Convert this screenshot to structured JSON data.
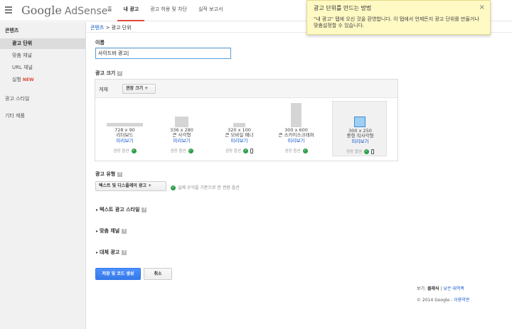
{
  "app": {
    "logo_google": "Google",
    "logo_product": "AdSense",
    "tabs": [
      "홈",
      "내 광고",
      "광고 허용 및 차단",
      "실적 보고서"
    ]
  },
  "sidebar": {
    "header": "콘텐츠",
    "items": [
      {
        "label": "광고 단위",
        "active": true
      },
      {
        "label": "맞춤 채널"
      },
      {
        "label": "URL 채널"
      },
      {
        "label": "실험",
        "badge": "NEW"
      }
    ],
    "top_items": [
      "광고 스타일",
      "기타 제품"
    ]
  },
  "breadcrumb": {
    "parent": "콘텐츠",
    "separator": ">",
    "current": "광고 단위"
  },
  "form": {
    "name_label": "이름",
    "name_value": "사이드바 광고|",
    "size_label": "광고 크기",
    "size_filter_label": "게재",
    "size_filter_value": "권장 크기 ÷",
    "ad_sizes": [
      {
        "dims": "728 x 90",
        "name": "리더보드",
        "preview": "미리보기",
        "rec": "권장 옵션",
        "mobile": false
      },
      {
        "dims": "336 x 280",
        "name": "큰 사각형",
        "preview": "미리보기",
        "rec": "권장 옵션",
        "mobile": false
      },
      {
        "dims": "320 x 100",
        "name": "큰 모바일 배너",
        "preview": "미리보기",
        "rec": "권장 옵션",
        "mobile": true
      },
      {
        "dims": "300 x 600",
        "name": "큰 스카이스크래퍼",
        "preview": "미리보기",
        "rec": "권장 옵션",
        "mobile": false
      },
      {
        "dims": "300 x 250",
        "name": "중형 직사각형",
        "preview": "미리보기",
        "rec": "권장 옵션",
        "mobile": true,
        "selected": true
      }
    ],
    "type_label": "광고 유형",
    "type_value": "텍스트 및 디스플레이 광고 ÷",
    "type_note": "실제 수익을 기준으로 한 권장 옵션",
    "sections": [
      "텍스트 광고 스타일",
      "맞춤 채널",
      "대체 광고"
    ],
    "save_label": "저장 및 코드 생성",
    "cancel_label": "취소"
  },
  "footer": {
    "view_label": "보기:",
    "view_current": "클래식",
    "view_separator": "|",
    "view_other": "낮은 대역폭",
    "copyright": "© 2014 Google -",
    "terms": "이용약관"
  },
  "tooltip": {
    "title": "광고 단위를 만드는 방법",
    "body": "\"내 광고\" 탭에 오신 것을 환영합니다. 이 탭에서 언제든지 광고 단위를 만들거나 맞춤설정할 수 있습니다.",
    "close": "×"
  }
}
